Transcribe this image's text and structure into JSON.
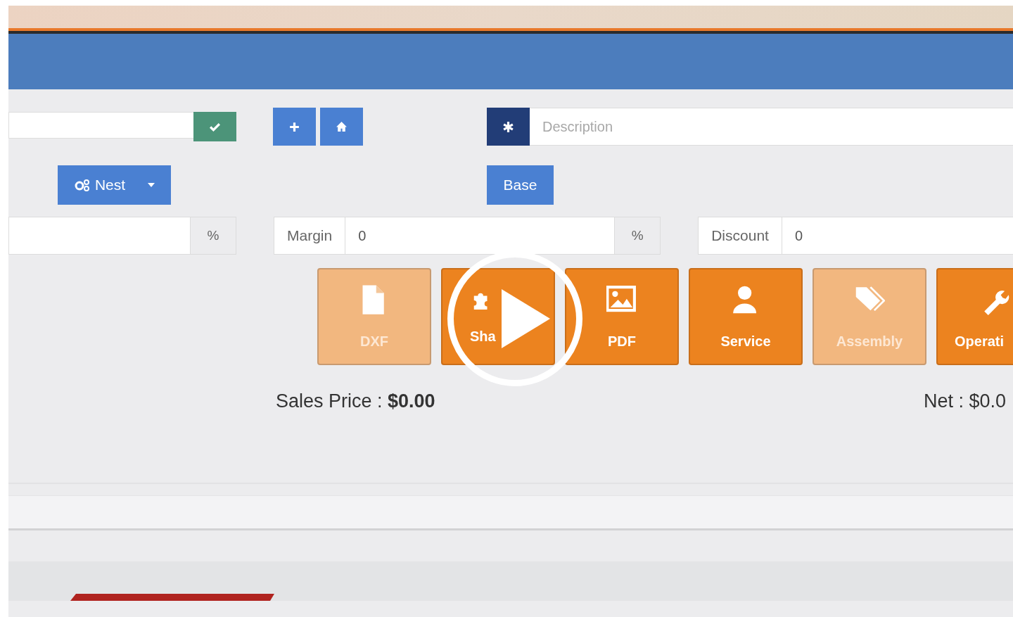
{
  "toolbar": {
    "description": {
      "placeholder": "Description"
    }
  },
  "buttons": [
    {
      "kind": "split",
      "label": "Nest"
    },
    {
      "kind": "plain",
      "label": "Base"
    }
  ],
  "inputs": [
    {
      "kind": "suffix",
      "addon": "%"
    },
    {
      "kind": "labeled",
      "label": "Margin",
      "value": "0",
      "addon": "%"
    },
    {
      "kind": "labeled",
      "label": "Discount",
      "value": "0"
    }
  ],
  "tiles": [
    {
      "label": "DXF",
      "disabled": true
    },
    {
      "label": "Sha",
      "disabled": false
    },
    {
      "label": "PDF",
      "disabled": false
    },
    {
      "label": "Service",
      "disabled": false
    },
    {
      "label": "Assembly",
      "disabled": true
    },
    {
      "label": "Operati",
      "disabled": false
    }
  ],
  "totals": {
    "sales_price": "Sales Price : **$0.00**",
    "net": "Net : $0.0"
  }
}
